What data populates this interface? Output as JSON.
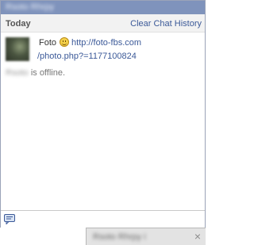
{
  "chat": {
    "title": "Rsoto Rhrpy",
    "history": {
      "day_label": "Today",
      "clear_label": "Clear Chat History"
    },
    "messages": [
      {
        "sender": "Foto",
        "emoticon": "smiley-icon",
        "link_part1": "http://foto-fbs.com",
        "link_part2": "/photo.php?=1177100824"
      }
    ],
    "status": {
      "name": "Rsoto",
      "text": "is offline."
    },
    "input": {
      "emoticon_button_icon": "emoticon-icon"
    }
  },
  "dock": {
    "tab_name": "Rsoto Rhrpy i",
    "close_label": "×"
  },
  "colors": {
    "titlebar": "#7f93bc",
    "link": "#3b5998",
    "header_bg": "#f2f2f2"
  }
}
